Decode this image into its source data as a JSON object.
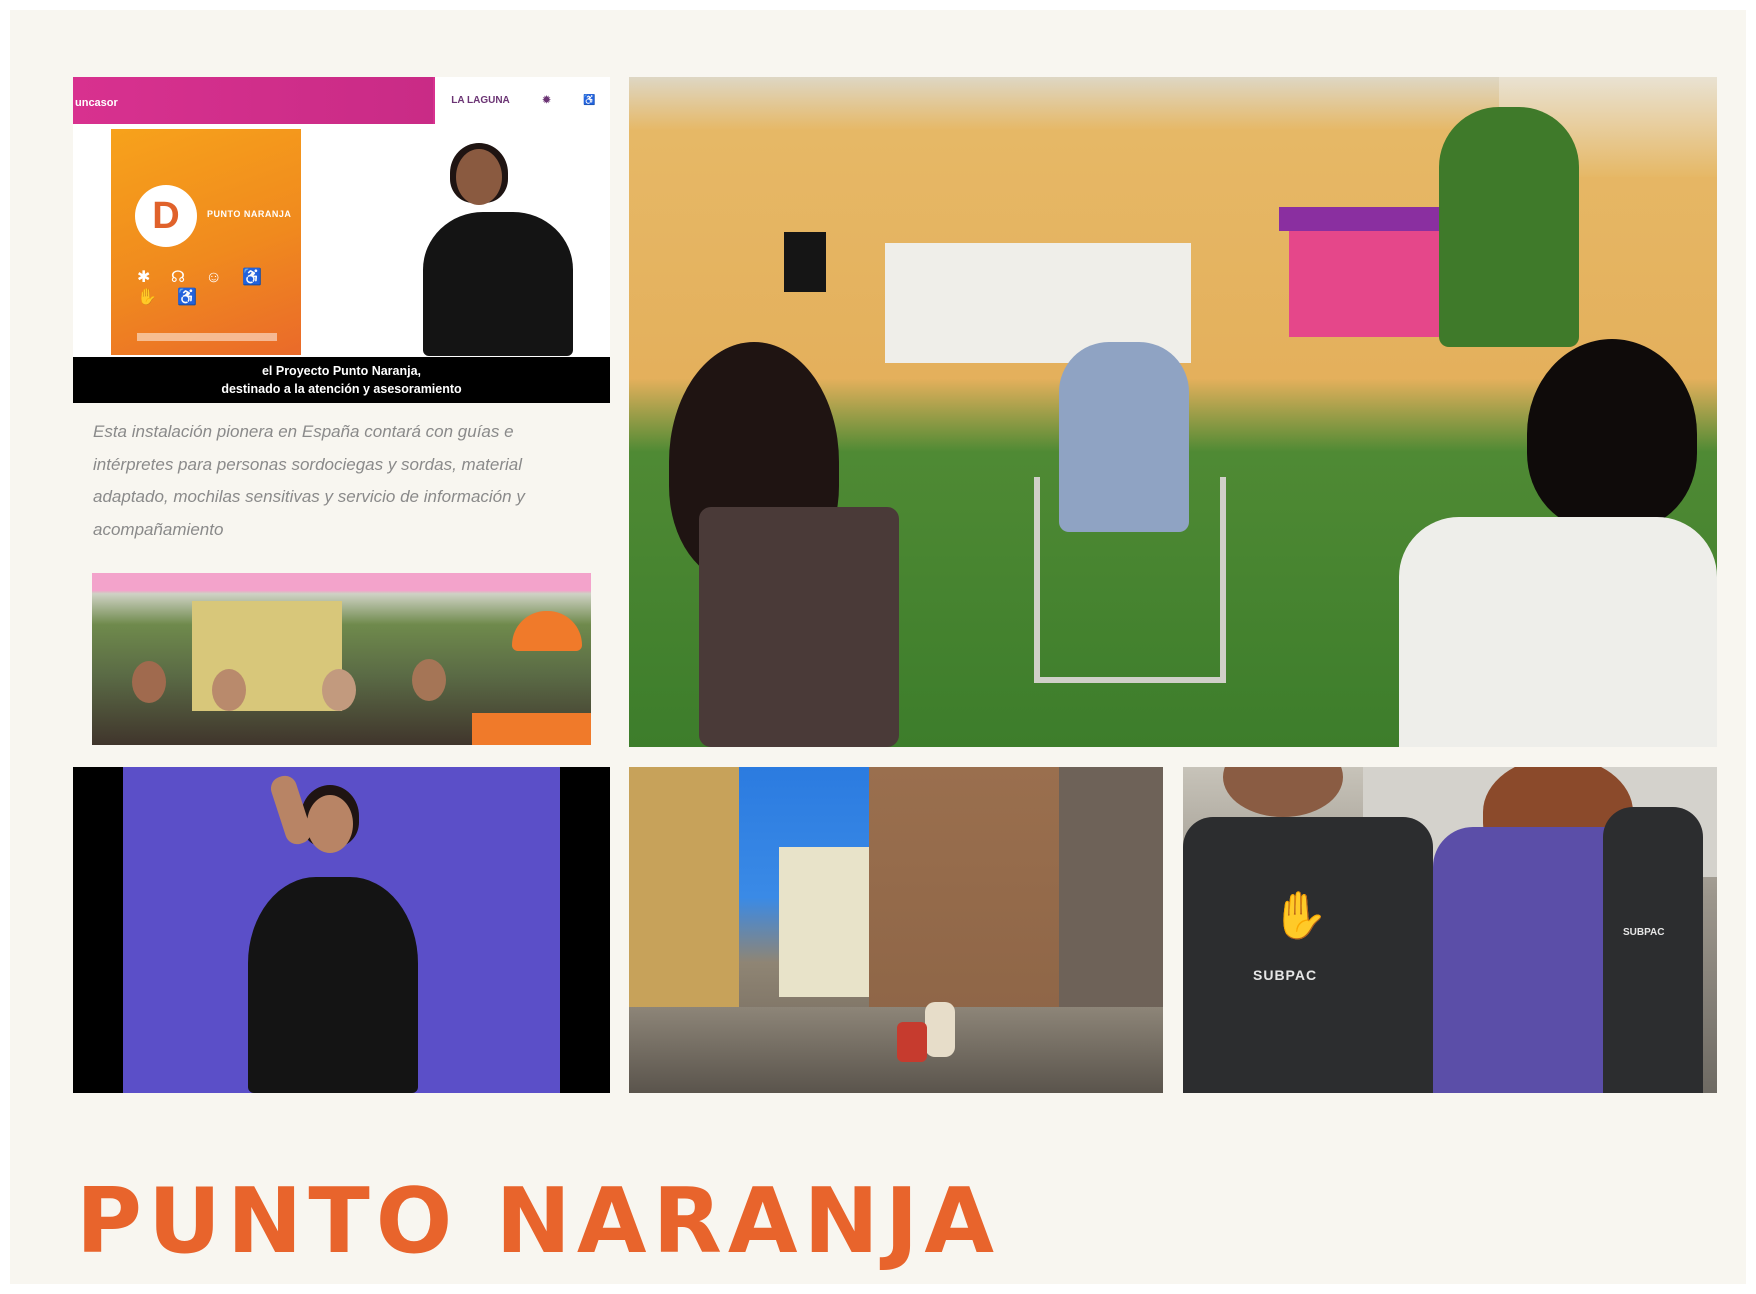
{
  "title": "PUNTO NARANJA",
  "brand_color": "#e8642c",
  "video_panel": {
    "header_label": "uncasor",
    "logo_text": "LA LAGUNA",
    "poster_letter": "D",
    "poster_title": "PUNTO NARANJA",
    "subtitle_line1": "el Proyecto Punto Naranja,",
    "subtitle_line2": "destinado a la atención y asesoramiento"
  },
  "caption_text": "Esta instalación pionera en España contará con guías e intérpretes para personas sordociegas y sordas, material adaptado, mochilas sensitivas y servicio de información y acompañamiento",
  "backpack_logo": "SUBPAC",
  "backpack_logo_2": "SUBPAC",
  "photos": {
    "people": "photo",
    "event": "photo",
    "signer": "photo",
    "street": "photo",
    "subpac": "photo"
  }
}
